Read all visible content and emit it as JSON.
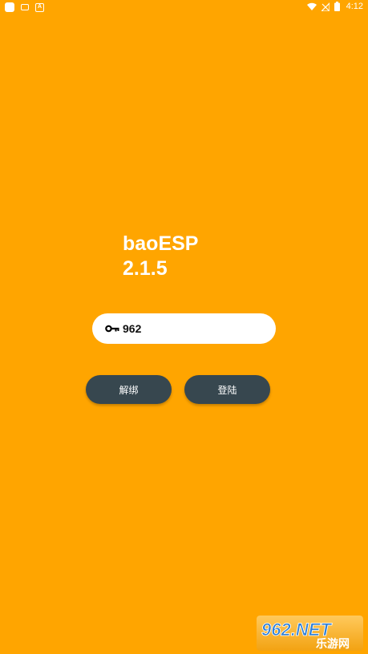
{
  "status_bar": {
    "time": "4:12",
    "icons": [
      "notification-square-icon",
      "gamepad-icon",
      "a-badge-icon",
      "wifi-icon",
      "signal-icon",
      "battery-icon"
    ]
  },
  "app": {
    "name": "baoESP",
    "version": "2.1.5"
  },
  "key_field": {
    "value": "962",
    "icon": "key-icon"
  },
  "buttons": {
    "unbind_label": "解绑",
    "login_label": "登陆"
  },
  "watermark": {
    "logo_text": "962.NET",
    "sub_text": "乐游网"
  },
  "colors": {
    "background": "#FFA500",
    "button": "#37474F",
    "field": "#FFFFFF"
  }
}
